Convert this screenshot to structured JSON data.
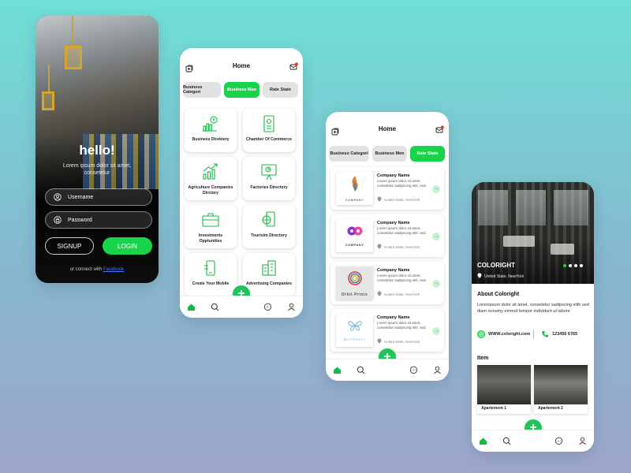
{
  "colors": {
    "accent": "#19d44b",
    "background_top": "#6fe0d6",
    "background_bottom": "#9ea6cc"
  },
  "login": {
    "greeting": "hello!",
    "subtitle": "Lorem ipsum dolor sit amet, consetetur",
    "username_placeholder": "Username",
    "password_placeholder": "Password",
    "signup_label": "SIGNUP",
    "login_label": "LOGIN",
    "connect_prefix": "or connect with",
    "connect_link": "Facebook"
  },
  "home_grid": {
    "title": "Home",
    "tabs": [
      {
        "label": "Business Categori",
        "active": false
      },
      {
        "label": "Business Man",
        "active": true
      },
      {
        "label": "Rate State",
        "active": false
      }
    ],
    "cards": [
      {
        "label": "Business Direktery",
        "icon": "money-chart-icon"
      },
      {
        "label": "Chamber Of Commerce",
        "icon": "document-icon"
      },
      {
        "label": "Agriculture Companies Dirctory",
        "icon": "growth-chart-icon"
      },
      {
        "label": "Factories Directory",
        "icon": "presentation-icon"
      },
      {
        "label": "Investments Opptunities",
        "icon": "briefcase-icon"
      },
      {
        "label": "Tourisim Directory",
        "icon": "globe-phone-icon"
      },
      {
        "label": "Create Your Mobile",
        "icon": "mobile-icon"
      },
      {
        "label": "Advertising Companies",
        "icon": "building-icon"
      }
    ],
    "fab": "+"
  },
  "home_list": {
    "title": "Home",
    "tabs": [
      {
        "label": "Business Categori",
        "active": false
      },
      {
        "label": "Business Men",
        "active": false
      },
      {
        "label": "Rate State",
        "active": true
      }
    ],
    "companies": [
      {
        "name": "Company Name",
        "desc": "Lorem ipsum dolor sit amet, consetetur sadipscing elitr, sed.",
        "location": "United State, NewYork",
        "logo_text": "COMPANY",
        "logo_icon": "flame-logo-icon"
      },
      {
        "name": "Company Name",
        "desc": "Lorem ipsum dolor sit amet, consetetur sadipscing elitr, sed.",
        "location": "United State, NewYork",
        "logo_text": "COMPANY",
        "logo_icon": "infinity-logo-icon"
      },
      {
        "name": "Company Name",
        "desc": "Lorem ipsum dolor sit amet, consetetur sadipscing elitr, sed.",
        "location": "United State, NewYork",
        "logo_text": "Orbit Prints",
        "logo_icon": "orbit-logo-icon"
      },
      {
        "name": "Company Name",
        "desc": "Lorem ipsum dolor sit amet, consetetur sadipscing elitr, sed.",
        "location": "United State, NewYork",
        "logo_text": "BUTTERFLY",
        "logo_icon": "butterfly-logo-icon"
      }
    ],
    "fab": "+"
  },
  "detail": {
    "name": "COLORIGHT",
    "location": "United State, NewYork",
    "about_heading": "About Coloright",
    "about_text": "Lorempsum dolor sit amet, consetetur sadipscing elith sed diam nonumy eirmod tempor individunt ut labore",
    "website": "WWW.coloright.com",
    "phone": "123456 6765",
    "item_heading": "Item",
    "items": [
      "Apartement 1",
      "Apartement 2"
    ],
    "fab": "+"
  }
}
